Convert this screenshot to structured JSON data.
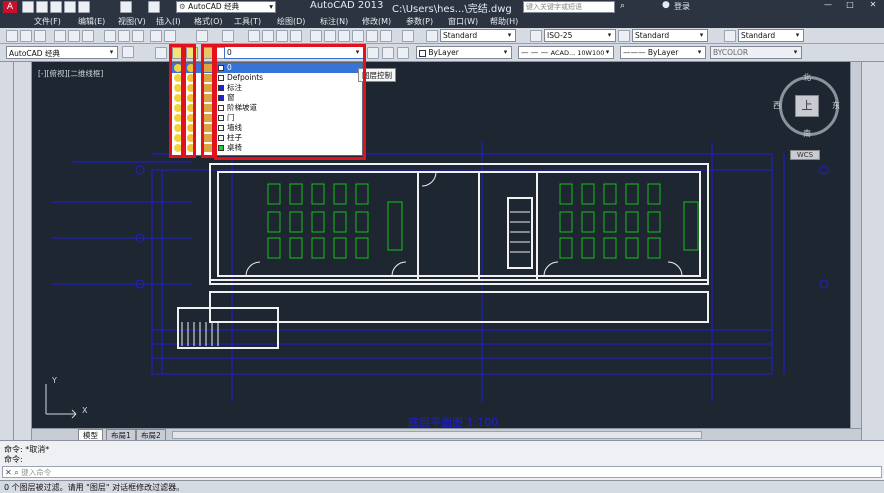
{
  "titlebar": {
    "workspace": "AutoCAD 经典",
    "app_title": "AutoCAD 2013",
    "file_path": "C:\\Users\\hes...\\完结.dwg",
    "search_placeholder": "键入关键字或短语",
    "login": "登录"
  },
  "menu": [
    "文件(F)",
    "编辑(E)",
    "视图(V)",
    "插入(I)",
    "格式(O)",
    "工具(T)",
    "绘图(D)",
    "标注(N)",
    "修改(M)",
    "参数(P)",
    "窗口(W)",
    "帮助(H)"
  ],
  "toolbar2": {
    "workspace_combo": "AutoCAD 经典",
    "layer_current": "0",
    "tooltip": "图层控制",
    "bylayer_color": "ByLayer",
    "linetype": "ACAD... 10W100",
    "lineweight": "ByLayer",
    "plotstyle": "BYCOLOR"
  },
  "styles": {
    "text_style": "Standard",
    "dim_style": "ISO-25",
    "table_style": "Standard",
    "mleader_style": "Standard"
  },
  "layer_list": [
    {
      "name": "0",
      "color": "#ffffff"
    },
    {
      "name": "Defpoints",
      "color": "#ffffff"
    },
    {
      "name": "标注",
      "color": "#1f1fd6"
    },
    {
      "name": "窗",
      "color": "#1f1fd6"
    },
    {
      "name": "阶梯坡道",
      "color": "#ffffff"
    },
    {
      "name": "门",
      "color": "#ffffff"
    },
    {
      "name": "墙线",
      "color": "#ffffff"
    },
    {
      "name": "柱子",
      "color": "#ffffff"
    },
    {
      "name": "桌椅",
      "color": "#27c93f"
    }
  ],
  "viewport": {
    "view_label": "[-][俯视][二维线框]",
    "north": "北",
    "south": "南",
    "east": "东",
    "west": "西",
    "top": "上",
    "wcs": "WCS",
    "plan_title": "底层平面图 1:100",
    "ucs_x": "X",
    "ucs_y": "Y"
  },
  "tabs": [
    "模型",
    "布局1",
    "布局2"
  ],
  "command": {
    "line1": "命令: *取消*",
    "line2": "命令:",
    "placeholder": "键入命令"
  },
  "status_text": "0 个图层被过滤。请用 \"图层\" 对话框修改过滤器。",
  "colors": {
    "drawing_blue": "#1f1fd6",
    "wall_white": "#f0f0f0",
    "furniture_green": "#12c312",
    "highlight_red": "#e3101e",
    "bg": "#1e2632"
  }
}
